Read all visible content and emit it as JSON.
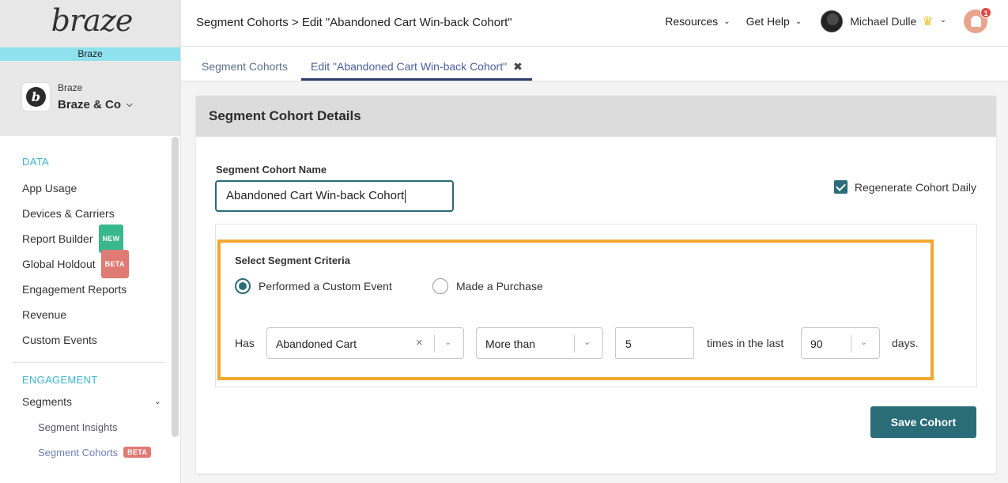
{
  "app": {
    "logo_text": "braze",
    "company_banner": "Braze",
    "company_label": "Braze",
    "company_name": "Braze & Co",
    "company_icon_letter": "b"
  },
  "sidebar": {
    "sections": [
      {
        "title": "DATA",
        "items": [
          {
            "label": "App Usage"
          },
          {
            "label": "Devices & Carriers"
          },
          {
            "label": "Report Builder",
            "badge": "NEW"
          },
          {
            "label": "Global Holdout",
            "badge": "BETA"
          },
          {
            "label": "Engagement Reports"
          },
          {
            "label": "Revenue"
          },
          {
            "label": "Custom Events"
          }
        ]
      },
      {
        "title": "ENGAGEMENT",
        "items": [
          {
            "label": "Segments"
          },
          {
            "label": "Segment Insights"
          },
          {
            "label": "Segment Cohorts",
            "badge": "BETA"
          }
        ]
      }
    ]
  },
  "topbar": {
    "breadcrumb": "Segment Cohorts > Edit \"Abandoned Cart Win-back Cohort\"",
    "resources": "Resources",
    "get_help": "Get Help",
    "user_name": "Michael Dulle",
    "notification_count": "1"
  },
  "tabs": [
    {
      "label": "Segment Cohorts"
    },
    {
      "label": "Edit \"Abandoned Cart Win-back Cohort\""
    }
  ],
  "card": {
    "title": "Segment Cohort Details",
    "name_label": "Segment Cohort Name",
    "name_value": "Abandoned Cart Win-back Cohort",
    "regenerate_label": "Regenerate Cohort Daily",
    "regenerate_checked": true,
    "criteria_title": "Select Segment Criteria",
    "radio_options": [
      "Performed a Custom Event",
      "Made a Purchase"
    ],
    "radio_selected": "Performed a Custom Event",
    "has_label": "Has",
    "event_select": "Abandoned Cart",
    "comparison_select": "More than",
    "count_value": "5",
    "times_label": "times in the last",
    "days_select": "90",
    "days_label": "days.",
    "save_label": "Save Cohort"
  },
  "colors": {
    "accent": "#2a6c78",
    "highlight": "#f0a830",
    "banner": "#8fe1ee",
    "badge_new": "#3ab88d",
    "badge_beta": "#e07a74"
  }
}
